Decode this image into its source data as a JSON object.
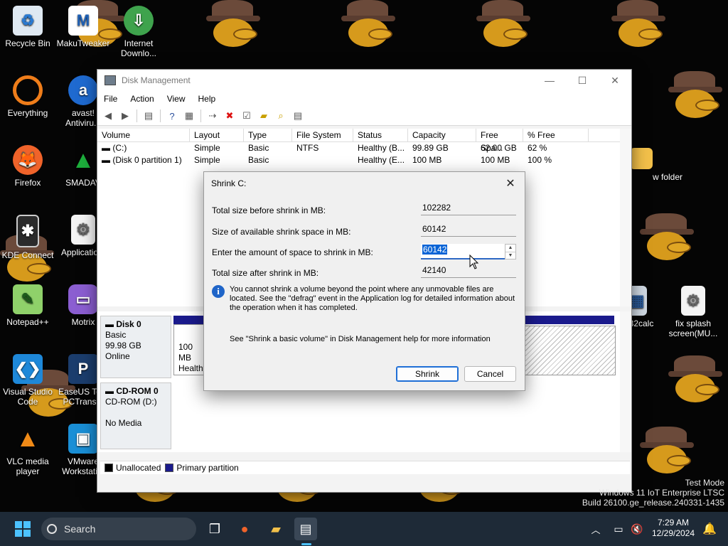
{
  "desktop": {
    "icons": [
      {
        "label": "Recycle Bin",
        "icon": "recycle-bin-icon"
      },
      {
        "label": "MakuTweaker",
        "icon": "makutweaker-icon"
      },
      {
        "label": "Internet Downlo...",
        "icon": "internet-download-manager-icon"
      },
      {
        "label": "Everything",
        "icon": "everything-search-icon"
      },
      {
        "label": "avast! Antiviru...",
        "icon": "avast-icon"
      },
      {
        "label": "Firefox",
        "icon": "firefox-icon"
      },
      {
        "label": "SMADAV",
        "icon": "smadav-icon"
      },
      {
        "label": "KDE Connect",
        "icon": "kde-connect-icon"
      },
      {
        "label": "Applicatio...",
        "icon": "application-settings-icon"
      },
      {
        "label": "Notepad++",
        "icon": "notepad-plus-plus-icon"
      },
      {
        "label": "Motrix",
        "icon": "motrix-icon"
      },
      {
        "label": "Visual Studio Code",
        "icon": "vscode-icon"
      },
      {
        "label": "EaseUS To... PCTrans...",
        "icon": "easeus-icon"
      },
      {
        "label": "VLC media player",
        "icon": "vlc-icon"
      },
      {
        "label": "VMware Workstati...",
        "icon": "vmware-icon"
      },
      {
        "label": "w folder",
        "icon": "folder-icon"
      },
      {
        "label": "32calc",
        "icon": "calculator-icon"
      },
      {
        "label": "fix splash screen(MU...",
        "icon": "settings-file-icon"
      }
    ]
  },
  "window": {
    "title": "Disk Management",
    "menu": [
      "File",
      "Action",
      "View",
      "Help"
    ],
    "columns": [
      "Volume",
      "Layout",
      "Type",
      "File System",
      "Status",
      "Capacity",
      "Free Spa...",
      "% Free"
    ],
    "volumes": [
      {
        "volume": "(C:)",
        "layout": "Simple",
        "type": "Basic",
        "fs": "NTFS",
        "status": "Healthy (B...",
        "capacity": "99.89 GB",
        "free": "62.00 GB",
        "pct": "62 %"
      },
      {
        "volume": "(Disk 0 partition 1)",
        "layout": "Simple",
        "type": "Basic",
        "fs": "",
        "status": "Healthy (E...",
        "capacity": "100 MB",
        "free": "100 MB",
        "pct": "100 %"
      }
    ],
    "disks": [
      {
        "name": "Disk 0",
        "type": "Basic",
        "size": "99.98 GB",
        "state": "Online",
        "partition_size": "100 MB",
        "partition_status": "Healthy"
      },
      {
        "name": "CD-ROM 0",
        "type": "CD-ROM (D:)",
        "state": "No Media"
      }
    ],
    "legend": [
      {
        "label": "Unallocated",
        "color": "#000000"
      },
      {
        "label": "Primary partition",
        "color": "#1a1a8c"
      }
    ]
  },
  "dialog": {
    "title": "Shrink C:",
    "total_before_label": "Total size before shrink in MB:",
    "total_before_value": "102282",
    "available_label": "Size of available shrink space in MB:",
    "available_value": "60142",
    "amount_label": "Enter the amount of space to shrink in MB:",
    "amount_value": "60142",
    "after_label": "Total size after shrink in MB:",
    "after_value": "42140",
    "info_text": "You cannot shrink a volume beyond the point where any unmovable files are located. See the \"defrag\" event in the Application log for detailed information about the operation when it has completed.",
    "help_text": "See \"Shrink a basic volume\" in Disk Management help for more information",
    "shrink_label": "Shrink",
    "cancel_label": "Cancel"
  },
  "watermark": {
    "line1": "Test Mode",
    "line2": "Windows 11 IoT Enterprise LTSC",
    "line3": "Build 26100.ge_release.240331-1435"
  },
  "taskbar": {
    "search_placeholder": "Search",
    "time": "7:29 AM",
    "date": "12/29/2024"
  }
}
